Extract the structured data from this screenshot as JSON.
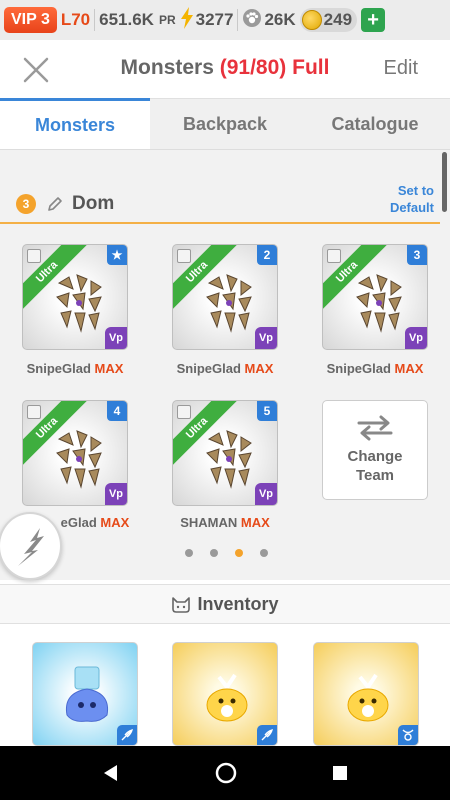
{
  "status": {
    "vip": "VIP 3",
    "level": "L70",
    "power": "651.6K",
    "power_suffix": "PR",
    "energy": "3277",
    "paw": "26K",
    "coins": "249",
    "plus": "+"
  },
  "header": {
    "title": "Monsters",
    "count": "(91/80) Full",
    "edit": "Edit"
  },
  "tabs": [
    "Monsters",
    "Backpack",
    "Catalogue"
  ],
  "team": {
    "number": "3",
    "name": "Dom",
    "set_default": [
      "Set to",
      "Default"
    ],
    "slots": [
      {
        "ribbon": "Ultra",
        "badge": "★",
        "name": "SnipeGlad",
        "max": "MAX",
        "element": "Vp"
      },
      {
        "ribbon": "Ultra",
        "badge": "2",
        "name": "SnipeGlad",
        "max": "MAX",
        "element": "Vp"
      },
      {
        "ribbon": "Ultra",
        "badge": "3",
        "name": "SnipeGlad",
        "max": "MAX",
        "element": "Vp"
      },
      {
        "ribbon": "Ultra",
        "badge": "4",
        "name": "eGlad",
        "max": "MAX",
        "element": "Vp"
      },
      {
        "ribbon": "Ultra",
        "badge": "5",
        "name": "SHAMAN",
        "max": "MAX",
        "element": "Vp"
      }
    ],
    "change_team": [
      "Change",
      "Team"
    ],
    "pages": 4,
    "active_page": 3
  },
  "inventory": {
    "title": "Inventory"
  },
  "colors": {
    "accent": "#3a86d8",
    "danger": "#e8323c",
    "ultra": "#3fae3f",
    "team_line": "#f4b046"
  }
}
